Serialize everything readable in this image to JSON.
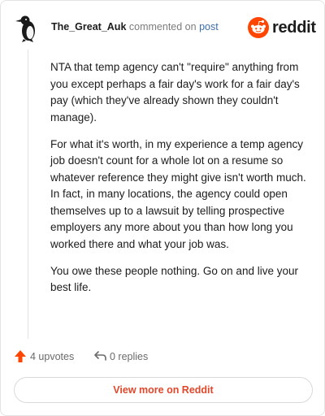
{
  "comment": {
    "username": "The_Great_Auk",
    "commented_text": "commented on",
    "post_link": "post",
    "brand": "reddit",
    "paragraphs": [
      "NTA that temp agency can't \"require\" anything from you except perhaps a fair day's work for a fair day's pay (which they've already shown they couldn't manage).",
      "For what it's worth, in my experience a temp agency job doesn't count for a whole lot on a resume so whatever reference they might give isn't worth much. In fact, in many locations, the agency could open themselves up to a lawsuit by telling prospective employers any more about you than how long you worked there and what your job was.",
      "You owe these people nothing. Go on and live your best life."
    ]
  },
  "actions": {
    "upvotes": "4 upvotes",
    "replies": "0 replies"
  },
  "footer": {
    "view_button": "View more on Reddit"
  },
  "colors": {
    "accent": "#FF4500",
    "link": "#3D6EA8",
    "view_button_text": "#E0472B"
  },
  "icons": {
    "avatar": "penguin-avatar-icon",
    "logo": "reddit-snoo-icon",
    "upvote": "upvote-arrow-icon",
    "reply": "reply-arrow-icon"
  }
}
